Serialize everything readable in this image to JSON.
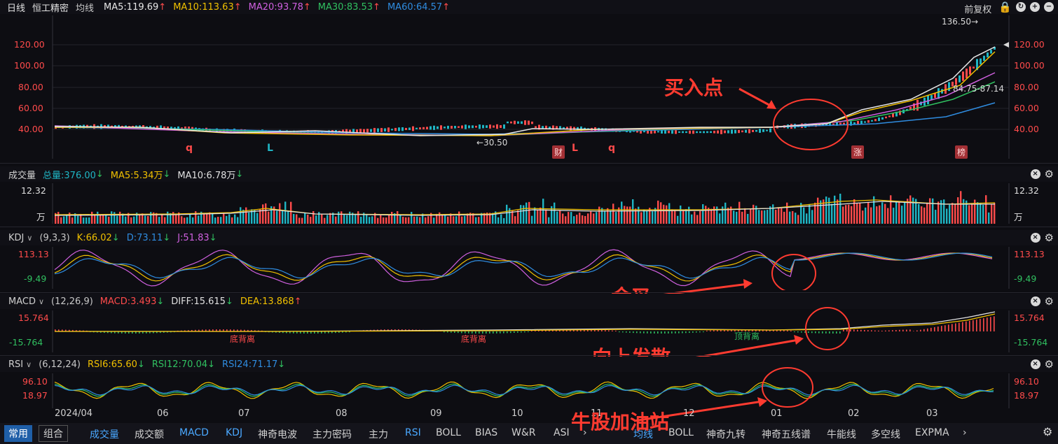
{
  "main_header": {
    "period": "日线",
    "stock_name": "恒工精密",
    "avg_line": "均线",
    "ma": [
      {
        "label": "MA5:119.69",
        "color": "#e8e8e8"
      },
      {
        "label": "MA10:113.63",
        "color": "#f0c000"
      },
      {
        "label": "MA20:93.78",
        "color": "#d060e0"
      },
      {
        "label": "MA30:83.53",
        "color": "#30c060"
      },
      {
        "label": "MA60:64.57",
        "color": "#2f8ce0"
      }
    ],
    "adjust": "前复权"
  },
  "price_axis": [
    "120.00",
    "100.00",
    "80.00",
    "60.00",
    "40.00"
  ],
  "price_labels": {
    "high": "136.50→",
    "low": "←30.50",
    "range": "84.75-87.14"
  },
  "price_tags": [
    "财",
    "涨",
    "榜"
  ],
  "price_signals": {
    "q1": "q",
    "l1": "L",
    "l2": "L",
    "q2": "q"
  },
  "volume_header": {
    "title": "成交量",
    "total": "总量:376.00",
    "ma5": "MA5:5.34万",
    "ma10": "MA10:6.78万"
  },
  "volume_axis": {
    "top": "12.32",
    "unit": "万"
  },
  "kdj_header": {
    "title": "KDJ",
    "params": "(9,3,3)",
    "k": "K:66.02",
    "d": "D:73.11",
    "j": "J:51.83"
  },
  "kdj_axis": [
    "113.13",
    "-9.49"
  ],
  "macd_header": {
    "title": "MACD",
    "params": "(12,26,9)",
    "macd": "MACD:3.493",
    "diff": "DIFF:15.615",
    "dea": "DEA:13.868"
  },
  "macd_axis": [
    "15.764",
    "-15.764"
  ],
  "macd_divergence": [
    "底背离",
    "底背离",
    "顶背离"
  ],
  "rsi_header": {
    "title": "RSI",
    "params": "(6,12,24)",
    "rsi6": "RSI6:65.60",
    "rsi12": "RSI12:70.04",
    "rsi24": "RSI24:71.17"
  },
  "rsi_axis": [
    "96.10",
    "18.97"
  ],
  "date_axis": [
    "2024/04",
    "06",
    "07",
    "08",
    "09",
    "10",
    "11",
    "12",
    "01",
    "02",
    "03"
  ],
  "tabs": {
    "mode": [
      "常用",
      "组合"
    ],
    "left": [
      "成交量",
      "成交额",
      "MACD",
      "KDJ",
      "神奇电波",
      "主力密码",
      "主力",
      "RSI",
      "BOLL",
      "BIAS",
      "W&R",
      "ASI"
    ],
    "right": [
      "均线",
      "BOLL",
      "神奇九转",
      "神奇五线谱",
      "牛能线",
      "多空线",
      "EXPMA"
    ]
  },
  "annotations": {
    "buy": "买入点",
    "golden_cross": "金叉",
    "diverge": "向上发散",
    "station": "牛股加油站"
  },
  "colors": {
    "up": "#ff4b4b",
    "down": "#1fb5c4",
    "background": "#0d0d12"
  }
}
